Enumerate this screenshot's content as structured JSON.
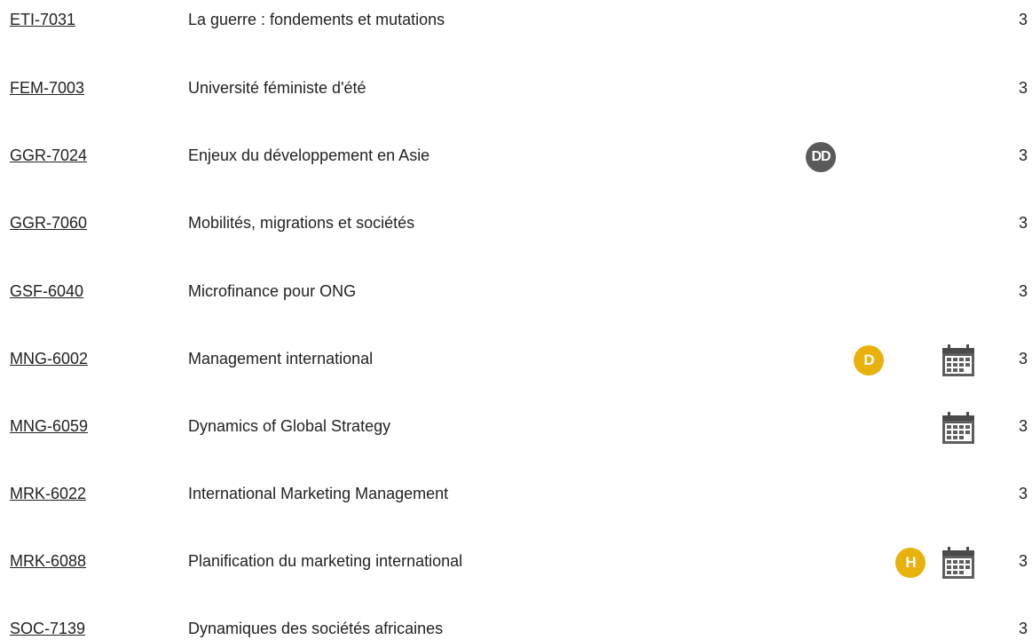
{
  "courses": [
    {
      "code": "ETI-7031",
      "title": "La guerre : fondements et mutations",
      "credits": "3"
    },
    {
      "code": "FEM-7003",
      "title": "Université féministe d'été",
      "credits": "3"
    },
    {
      "code": "GGR-7024",
      "title": "Enjeux du développement en Asie",
      "credits": "3",
      "badge": "DD",
      "badge_color": "#5a5a5a"
    },
    {
      "code": "GGR-7060",
      "title": "Mobilités, migrations et sociétés",
      "credits": "3"
    },
    {
      "code": "GSF-6040",
      "title": "Microfinance pour ONG",
      "credits": "3"
    },
    {
      "code": "MNG-6002",
      "title": "Management international",
      "credits": "3",
      "badge": "D",
      "badge_color": "#e8b10c",
      "calendar_icon": "calendar-icon"
    },
    {
      "code": "MNG-6059",
      "title": "Dynamics of Global Strategy",
      "credits": "3",
      "calendar_icon": "calendar-icon"
    },
    {
      "code": "MRK-6022",
      "title": "International Marketing Management",
      "credits": "3"
    },
    {
      "code": "MRK-6088",
      "title": "Planification du marketing international",
      "credits": "3",
      "badge": "H",
      "badge_color": "#e8b10c",
      "calendar_icon": "calendar-icon"
    },
    {
      "code": "SOC-7139",
      "title": "Dynamiques des sociétés africaines",
      "credits": "3"
    }
  ]
}
